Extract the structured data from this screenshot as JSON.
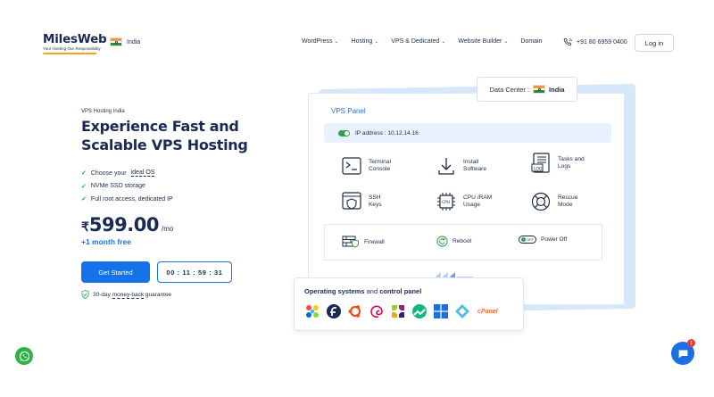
{
  "brand": {
    "name": "MilesWeb",
    "tagline": "Your Hosting Our Responsibility"
  },
  "country": {
    "label": "India"
  },
  "nav": {
    "items": [
      {
        "label": "WordPress",
        "has_dropdown": true
      },
      {
        "label": "Hosting",
        "has_dropdown": true
      },
      {
        "label": "VPS & Dedicated",
        "has_dropdown": true
      },
      {
        "label": "Website Builder",
        "has_dropdown": true
      },
      {
        "label": "Domain",
        "has_dropdown": false
      }
    ],
    "chevron": "⌄",
    "phone": "+91 80 6959 0400",
    "login": "Log in"
  },
  "hero": {
    "eyebrow": "VPS Hosting India",
    "title": "Experience Fast and Scalable VPS Hosting",
    "features": [
      {
        "pre": "Choose your ",
        "link": "ideal OS"
      },
      {
        "pre": "NVMe SSD storage",
        "link": ""
      },
      {
        "pre": "Full root access, dedicated IP",
        "link": ""
      }
    ],
    "price_currency": "₹",
    "price_value": "599.00",
    "price_unit": "/mo",
    "promo": "+1 month free",
    "cta": "Get Started",
    "timer": "00 : 11 : 59 : 31",
    "guarantee_pre": "30-day ",
    "guarantee_link": "money-back",
    "guarantee_post": " guarantee"
  },
  "panel": {
    "title": "VPS Panel",
    "data_center_label": "Data Center :",
    "data_center_country": "India",
    "ip_label": "IP address : 10.12.14.16",
    "features": [
      {
        "l1": "Terminal",
        "l2": "Console"
      },
      {
        "l1": "Install",
        "l2": "Software"
      },
      {
        "l1": "Tasks and",
        "l2": "Logs"
      },
      {
        "l1": "SSH",
        "l2": "Keys"
      },
      {
        "l1": "CPU /RAM",
        "l2": "Usage"
      },
      {
        "l1": "Rescue",
        "l2": "Mode"
      }
    ],
    "cpu_chip": "CPU",
    "bottom": {
      "firewall": "Firewall",
      "reboot": "Reboot",
      "power_off": "Power Off",
      "off_pill": "OFF"
    }
  },
  "os": {
    "title_bold1": "Operating systems",
    "title_mid": " and ",
    "title_bold2": "control panel",
    "cpanel": "cPanel"
  },
  "chat": {
    "badge": "1"
  },
  "colors": {
    "primary": "#1572e8",
    "navy": "#1a2a55",
    "green": "#2fa14e",
    "accent_orange": "#f6a21a"
  }
}
